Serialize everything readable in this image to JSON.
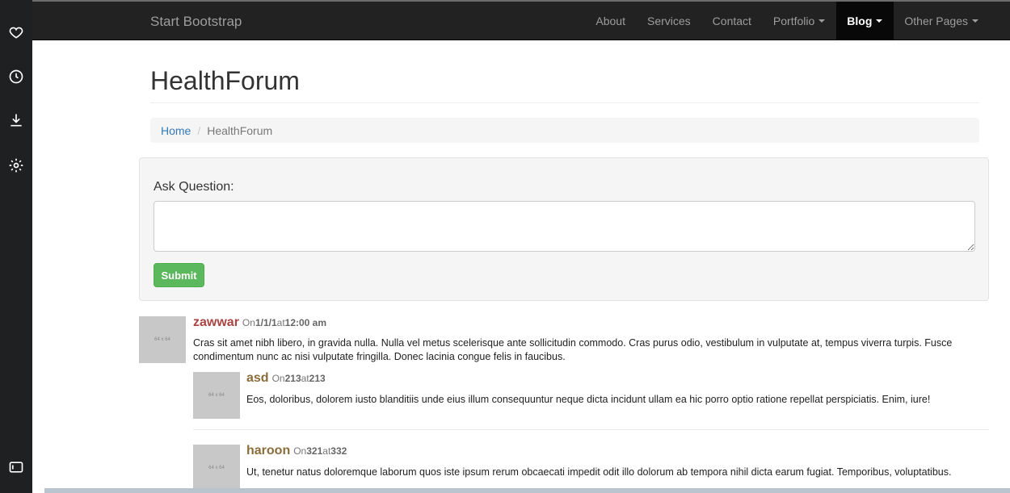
{
  "navbar": {
    "brand": "Start Bootstrap",
    "items": [
      {
        "label": "About",
        "dropdown": false
      },
      {
        "label": "Services",
        "dropdown": false
      },
      {
        "label": "Contact",
        "dropdown": false
      },
      {
        "label": "Portfolio",
        "dropdown": true
      },
      {
        "label": "Blog",
        "dropdown": true,
        "active": true
      },
      {
        "label": "Other Pages",
        "dropdown": true
      }
    ]
  },
  "page": {
    "title": "HealthForum",
    "breadcrumb": {
      "home": "Home",
      "current": "HealthForum"
    }
  },
  "ask": {
    "label": "Ask Question:",
    "value": "",
    "submit_label": "Submit"
  },
  "comments": [
    {
      "thumb": "64 x 64",
      "name": "zawwar",
      "on": "On",
      "date": "1/1/1",
      "at": "at",
      "time": "12:00 am",
      "name_color": "#a94442",
      "text": "Cras sit amet nibh libero, in gravida nulla. Nulla vel metus scelerisque ante sollicitudin commodo. Cras purus odio, vestibulum in vulputate at, tempus viverra turpis. Fusce condimentum nunc ac nisi vulputate fringilla. Donec lacinia congue felis in faucibus.",
      "replies": [
        {
          "thumb": "64 x 64",
          "name": "asd",
          "on": "On",
          "date": "213",
          "at": "at",
          "time": "213",
          "name_color": "#8a6d3b",
          "text": "Eos, doloribus, dolorem iusto blanditiis unde eius illum consequuntur neque dicta incidunt ullam ea hic porro optio ratione repellat perspiciatis. Enim, iure!"
        },
        {
          "thumb": "64 x 64",
          "name": "haroon",
          "on": "On",
          "date": "321",
          "at": "at",
          "time": "332",
          "name_color": "#8a6d3b",
          "text": "Ut, tenetur natus doloremque laborum quos iste ipsum rerum obcaecati impedit odit illo dolorum ab tempora nihil dicta earum fugiat. Temporibus, voluptatibus."
        }
      ]
    }
  ],
  "sidebar": {
    "icons": [
      "heart-icon",
      "clock-icon",
      "download-icon",
      "gear-icon",
      "sidebar-toggle-icon"
    ]
  }
}
